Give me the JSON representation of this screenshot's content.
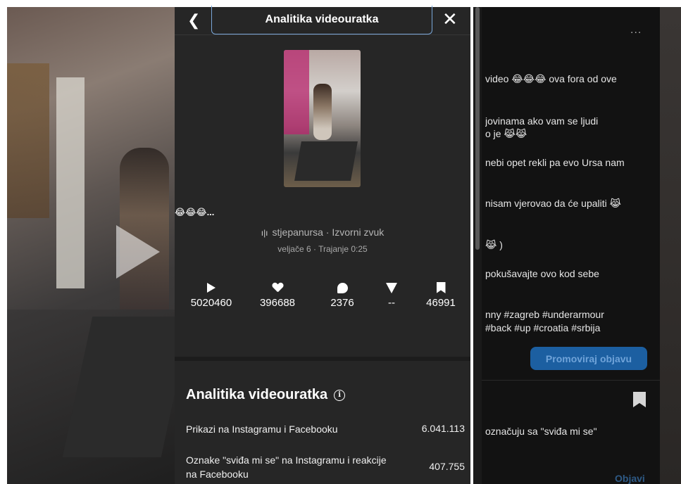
{
  "dialog": {
    "title": "Analitika videouratka",
    "back_icon": "chevron-left-icon",
    "close_icon": "close-icon"
  },
  "post": {
    "caption_preview": "😂😂😂...",
    "author": "stjepanursa",
    "audio": "Izvorni zvuk",
    "author_line": "stjepanursa · Izvorni zvuk",
    "date_line": "veljače 6 · Trajanje 0:25"
  },
  "stats": [
    {
      "icon": "play-icon",
      "value": "5020460"
    },
    {
      "icon": "heart-icon",
      "value": "396688"
    },
    {
      "icon": "comment-icon",
      "value": "2376"
    },
    {
      "icon": "send-icon",
      "value": "--"
    },
    {
      "icon": "bookmark-icon",
      "value": "46991"
    }
  ],
  "analytics": {
    "title": "Analitika videouratka",
    "rows": [
      {
        "label": "Prikazi na Instagramu i Facebooku",
        "value": "6.041.113"
      },
      {
        "label_line1": "Oznake \"sviđa mi se\" na Instagramu i reakcije",
        "label_line2": "na Facebooku",
        "value": "407.755"
      }
    ]
  },
  "background_right": {
    "more": "...",
    "lines": [
      "video 😂😂😂 ova fora od ove",
      "jovinama ako vam se ljudi",
      "o je 😹😹",
      "nebi opet rekli pa evo Ursa nam",
      "nisam vjerovao da će upaliti 😹",
      "😹 )",
      "pokušavajte ovo kod sebe",
      "nny #zagreb #underarmour",
      "#back #up #croatia #srbija"
    ],
    "promo_button": "Promoviraj objavu",
    "likes_text": "označuju sa \"sviđa mi se\"",
    "publish": "Objavi"
  }
}
